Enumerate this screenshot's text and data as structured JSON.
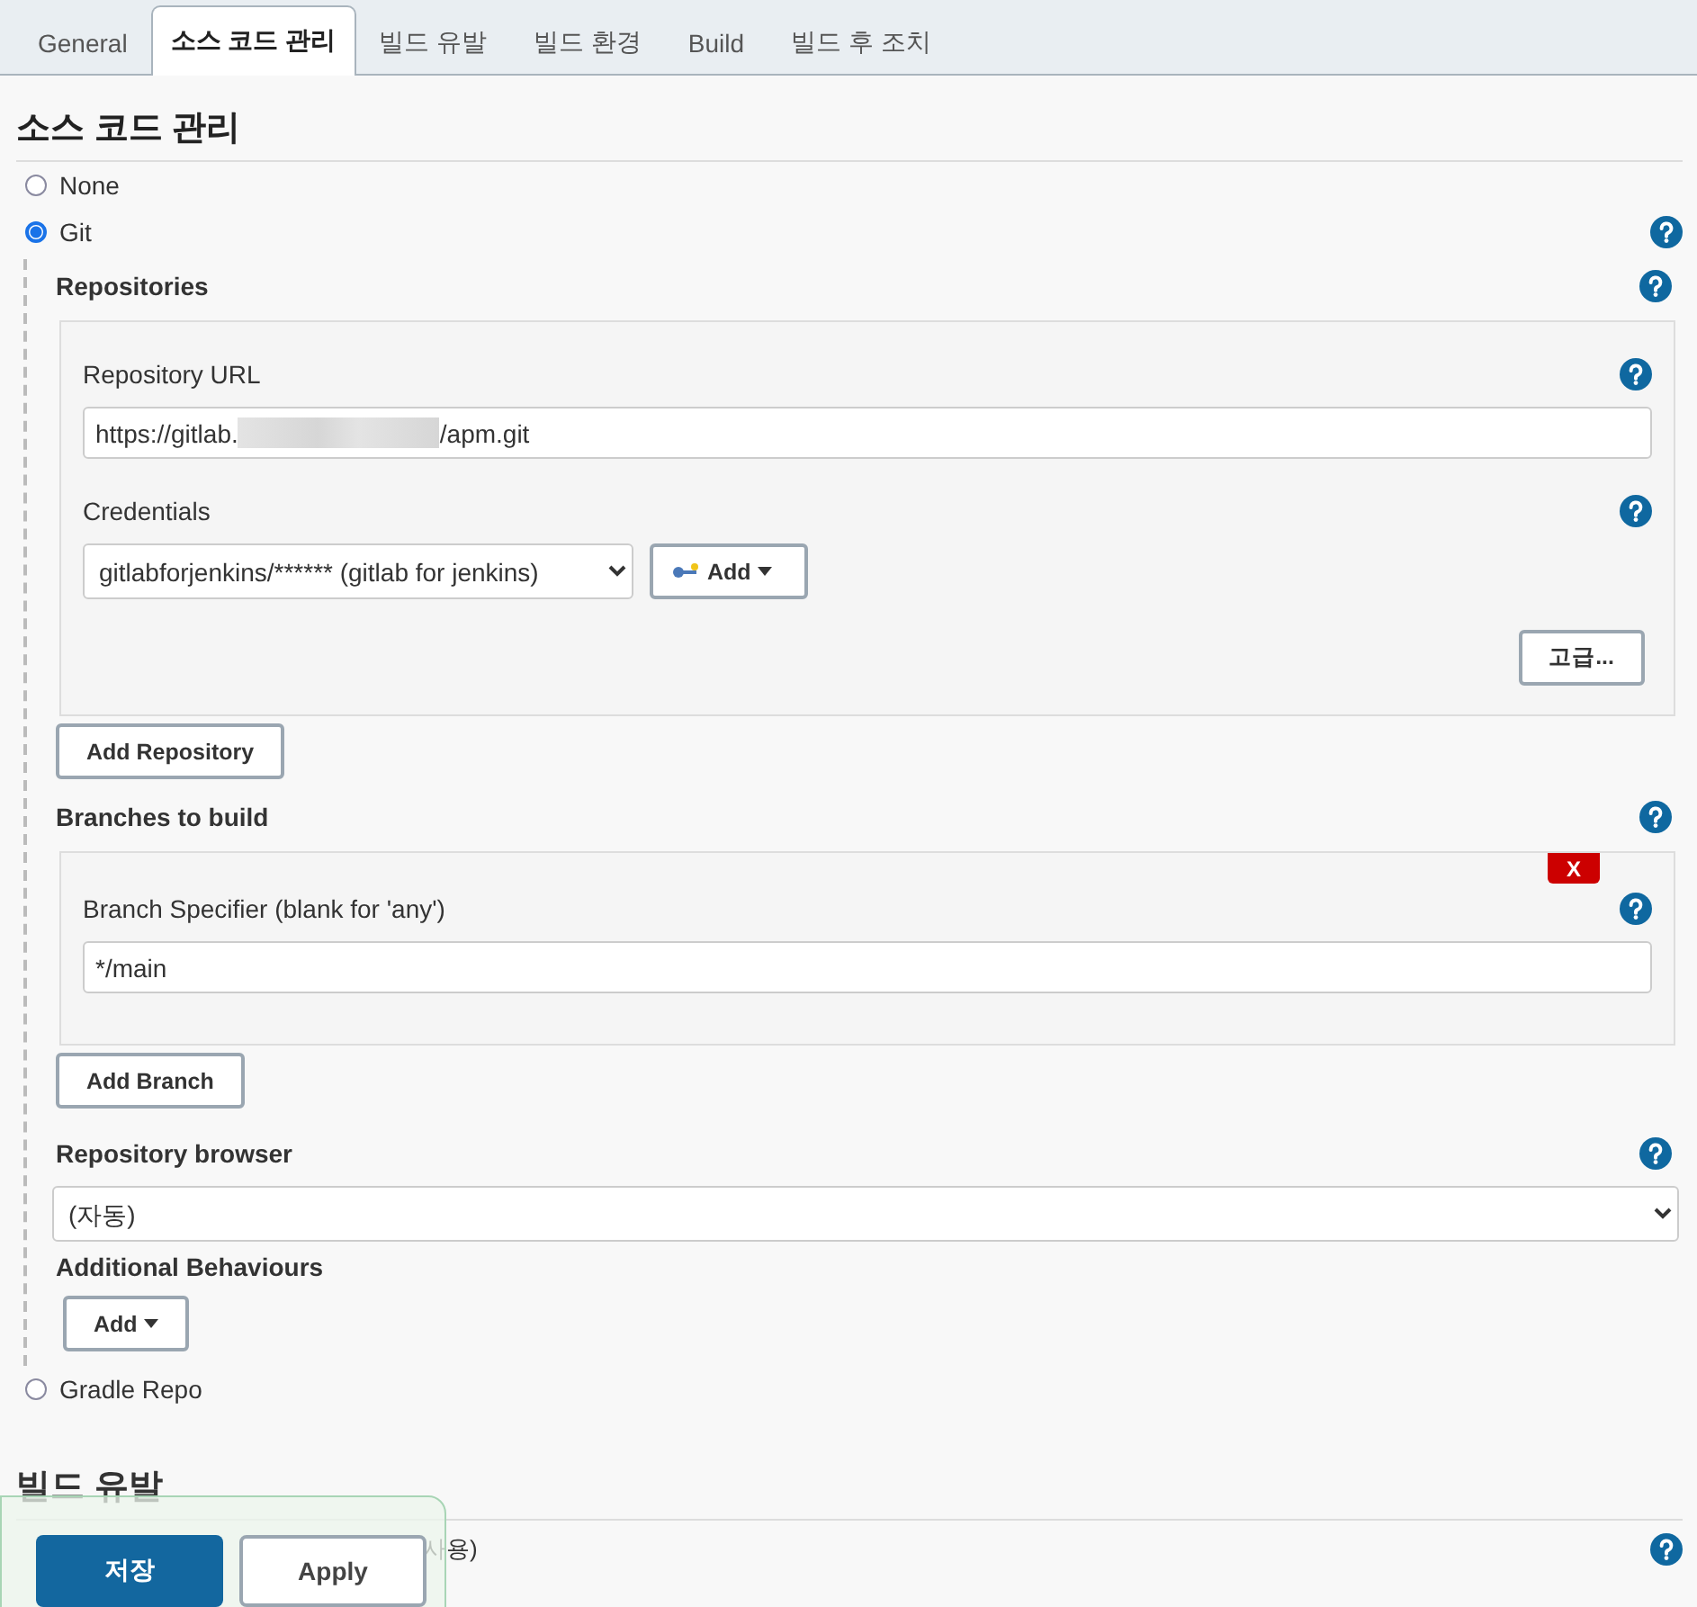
{
  "tabs": [
    {
      "label": "General",
      "selected": false
    },
    {
      "label": "소스 코드 관리",
      "selected": true
    },
    {
      "label": "빌드 유발",
      "selected": false
    },
    {
      "label": "빌드 환경",
      "selected": false
    },
    {
      "label": "Build",
      "selected": false
    },
    {
      "label": "빌드 후 조치",
      "selected": false
    }
  ],
  "section_title": "소스 코드 관리",
  "scm_options": [
    {
      "label": "None",
      "selected": false
    },
    {
      "label": "Git",
      "selected": true,
      "config": {
        "repositories": {
          "label": "Repositories",
          "items": [
            {
              "url_label": "Repository URL",
              "url_value_parts": [
                "https://gitlab.",
                "/apm.git"
              ],
              "credentials_label": "Credentials",
              "credentials_value": "gitlabforjenkins/****** (gitlab for jenkins)",
              "add_button": "Add",
              "advanced_button": "고급..."
            }
          ],
          "add_button": "Add Repository"
        },
        "branches": {
          "label": "Branches to build",
          "items": [
            {
              "delete_button": "X",
              "specifier_label": "Branch Specifier (blank for 'any')",
              "value": "*/main"
            }
          ],
          "add_button": "Add Branch"
        },
        "repository_browser": {
          "label": "Repository browser",
          "value": "(자동)"
        },
        "additional_behaviours": {
          "label": "Additional Behaviours",
          "add_button": "Add"
        }
      }
    },
    {
      "label": "Gradle Repo",
      "selected": false
    }
  ],
  "next_section": {
    "title": "빌드 유발",
    "row_text": "사용)"
  },
  "save_bar": {
    "buttons": [
      {
        "label": "저장",
        "kind": "primary"
      },
      {
        "label": "Apply",
        "kind": "secondary"
      }
    ]
  }
}
